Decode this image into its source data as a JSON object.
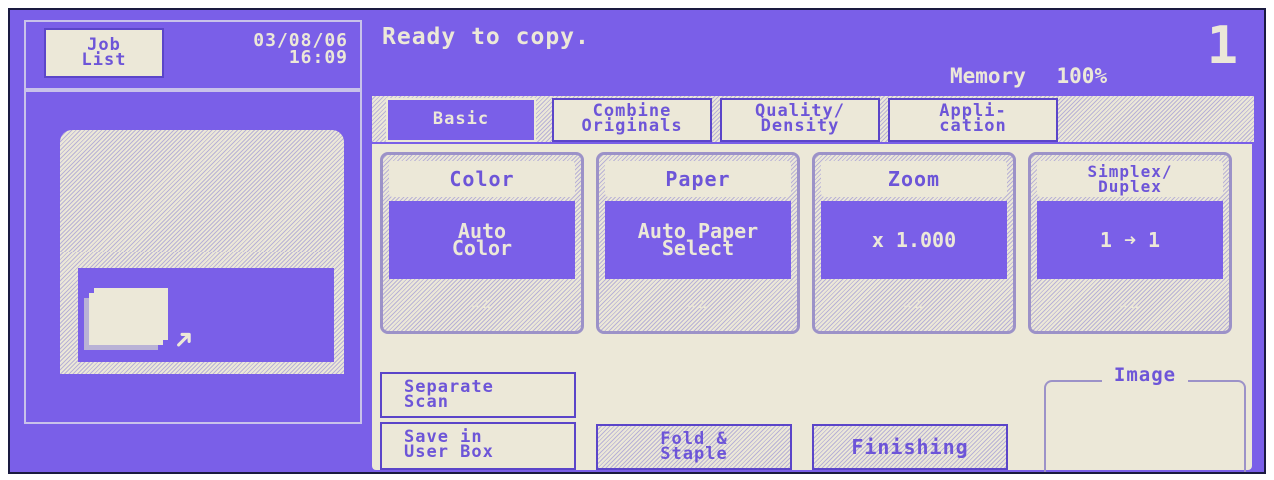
{
  "header": {
    "job_list": "Job\nList",
    "date": "03/08/06",
    "time": "16:09",
    "status": "Ready to copy.",
    "memory_label": "Memory",
    "memory_value": "100%",
    "copy_count": "1"
  },
  "tabs": [
    {
      "label": "Basic",
      "active": true
    },
    {
      "label": "Combine\nOriginals",
      "active": false
    },
    {
      "label": "Quality/\nDensity",
      "active": false
    },
    {
      "label": "Appli-\ncation",
      "active": false
    }
  ],
  "settings": [
    {
      "title": "Color",
      "value": "Auto\nColor"
    },
    {
      "title": "Paper",
      "value": "Auto Paper\nSelect"
    },
    {
      "title": "Zoom",
      "value": "x 1.000"
    },
    {
      "title": "Simplex/\nDuplex",
      "value": "1 ➜ 1"
    }
  ],
  "dots": "∴∴",
  "buttons": {
    "separate_scan": "Separate\nScan",
    "save_in_user_box": "Save in\nUser Box",
    "fold_staple": "Fold &\nStaple",
    "finishing": "Finishing"
  },
  "image_label": "Image",
  "icons": {
    "arrow": "pointer-arrow-icon"
  },
  "colors": {
    "screen": "#7a5fe8",
    "cream": "#ece8d8",
    "accent": "#6d55d8"
  }
}
